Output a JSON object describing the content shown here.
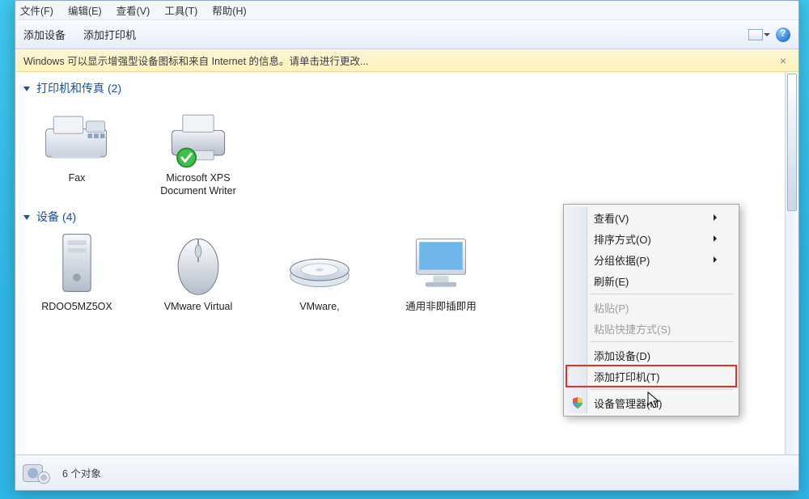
{
  "menubar": {
    "file": "文件(F)",
    "edit": "编辑(E)",
    "view": "查看(V)",
    "tools": "工具(T)",
    "help": "帮助(H)"
  },
  "toolbar": {
    "add_device": "添加设备",
    "add_printer": "添加打印机"
  },
  "infobar": {
    "message": "Windows 可以显示增强型设备图标和来自 Internet 的信息。请单击进行更改..."
  },
  "groups": {
    "printers": {
      "title": "打印机和传真",
      "count": "(2)"
    },
    "devices": {
      "title": "设备",
      "count": "(4)"
    }
  },
  "items": {
    "fax": "Fax",
    "xps": "Microsoft XPS Document Writer",
    "hdd": "RDOO5MZ5OX",
    "mouse": "VMware Virtual",
    "disk": "VMware,",
    "monitor": "通用非即插即用"
  },
  "statusbar": {
    "count": "6 个对象"
  },
  "context_menu": {
    "view": "查看(V)",
    "sort": "排序方式(O)",
    "group": "分组依据(P)",
    "refresh": "刷新(E)",
    "paste": "粘贴(P)",
    "paste_shortcut": "粘贴快捷方式(S)",
    "add_device": "添加设备(D)",
    "add_printer": "添加打印机(T)",
    "device_manager": "设备管理器(M)"
  }
}
